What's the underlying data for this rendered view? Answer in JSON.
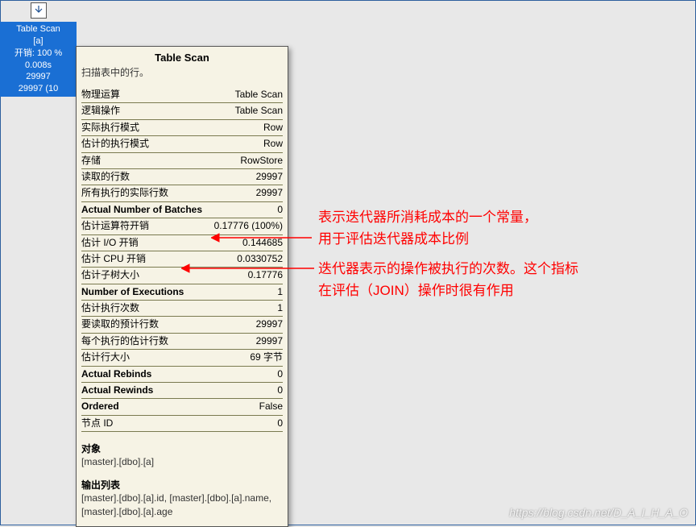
{
  "plan_node": {
    "line1": "Table Scan",
    "line2": "[a]",
    "line3": "开销: 100 %",
    "line4": "0.008s",
    "line5": "29997",
    "line6": "29997 (10"
  },
  "tooltip": {
    "title": "Table Scan",
    "subtitle": "扫描表中的行。",
    "rows": [
      {
        "k": "物理运算",
        "v": "Table Scan",
        "bold": false
      },
      {
        "k": "逻辑操作",
        "v": "Table Scan",
        "bold": false
      },
      {
        "k": "实际执行模式",
        "v": "Row",
        "bold": false
      },
      {
        "k": "估计的执行模式",
        "v": "Row",
        "bold": false
      },
      {
        "k": "存储",
        "v": "RowStore",
        "bold": false
      },
      {
        "k": "读取的行数",
        "v": "29997",
        "bold": false
      },
      {
        "k": "所有执行的实际行数",
        "v": "29997",
        "bold": false
      },
      {
        "k": "Actual Number of Batches",
        "v": "0",
        "bold": true
      },
      {
        "k": "估计运算符开销",
        "v": "0.17776 (100%)",
        "bold": false
      },
      {
        "k": "估计 I/O 开销",
        "v": "0.144685",
        "bold": false
      },
      {
        "k": "估计 CPU 开销",
        "v": "0.0330752",
        "bold": false
      },
      {
        "k": "估计子树大小",
        "v": "0.17776",
        "bold": false
      },
      {
        "k": "Number of Executions",
        "v": "1",
        "bold": true
      },
      {
        "k": "估计执行次数",
        "v": "1",
        "bold": false
      },
      {
        "k": "要读取的预计行数",
        "v": "29997",
        "bold": false
      },
      {
        "k": "每个执行的估计行数",
        "v": "29997",
        "bold": false
      },
      {
        "k": "估计行大小",
        "v": "69 字节",
        "bold": false
      },
      {
        "k": "Actual Rebinds",
        "v": "0",
        "bold": true
      },
      {
        "k": "Actual Rewinds",
        "v": "0",
        "bold": true
      },
      {
        "k": "Ordered",
        "v": "False",
        "bold": true
      },
      {
        "k": "节点 ID",
        "v": "0",
        "bold": false
      }
    ],
    "object_label": "对象",
    "object_text": "[master].[dbo].[a]",
    "output_label": "输出列表",
    "output_text": "[master].[dbo].[a].id, [master].[dbo].[a].name, [master].[dbo].[a].age"
  },
  "annotations": {
    "a1_line1": "表示迭代器所消耗成本的一个常量，",
    "a1_line2": "用于评估迭代器成本比例",
    "a2_line1": "迭代器表示的操作被执行的次数。这个指标",
    "a2_line2": "在评估（JOIN）操作时很有作用"
  },
  "watermark": "https://blog.csdn.net/D_A_I_H_A_O"
}
